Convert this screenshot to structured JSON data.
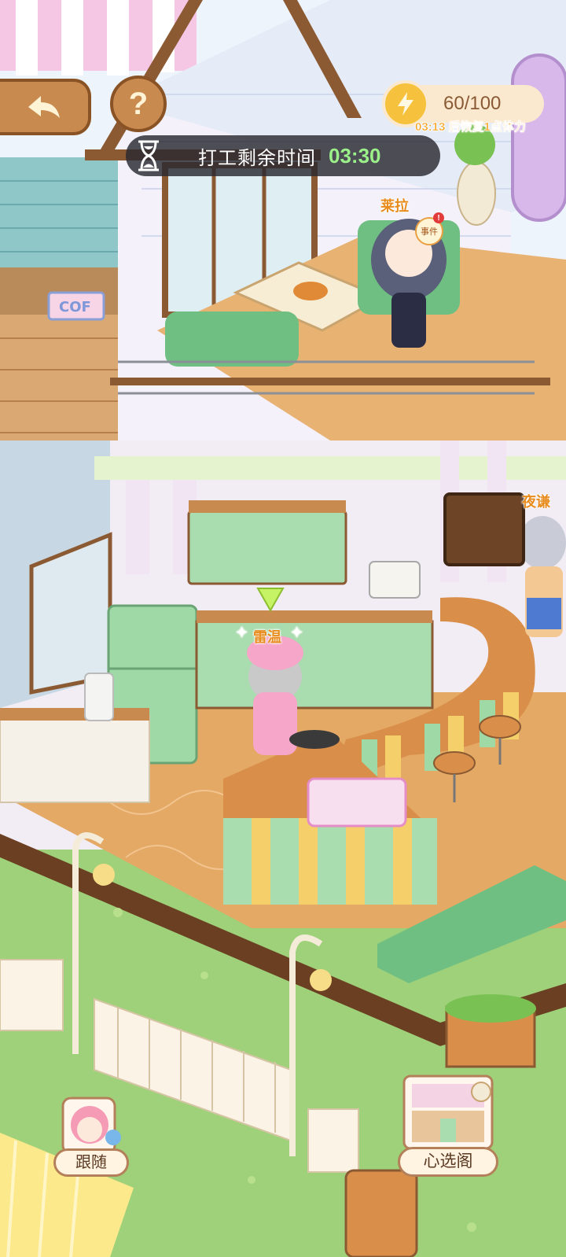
{
  "hud": {
    "timer_label": "打工剩余时间",
    "timer_value": "03:30",
    "energy_value": "60/100",
    "energy_note": "03:13 后恢复1点体力",
    "help_symbol": "?"
  },
  "characters": {
    "top_left_name": "莱拉",
    "event_label": "事件",
    "right_name": "夜谦",
    "chef_name": "雷温"
  },
  "buttons": {
    "follow_label": "跟随",
    "gallery_label": "心选阁"
  },
  "signs": {
    "cafe_sign": "COF"
  },
  "colors": {
    "wood": "#c98a50",
    "floor": "#e3a965",
    "grass": "#9fd07a",
    "accent_green": "#9fe0a8",
    "timer_text": "#9cf08a"
  }
}
